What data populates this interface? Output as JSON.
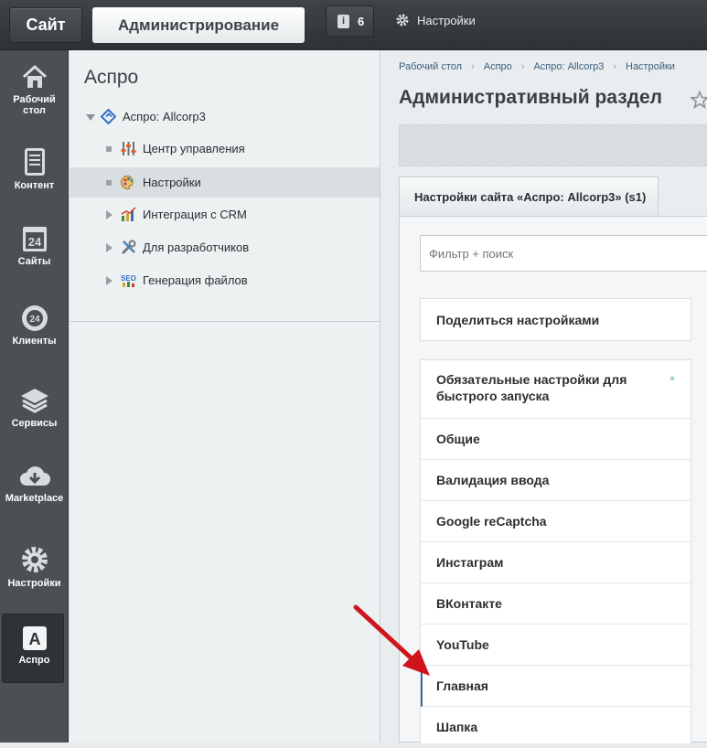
{
  "topbar": {
    "site_label": "Сайт",
    "admin_label": "Администрирование",
    "notifications_count": "6",
    "settings_label": "Настройки"
  },
  "leftmenu": {
    "items": [
      {
        "label": "Рабочий стол",
        "icon": "home-icon"
      },
      {
        "label": "Контент",
        "icon": "document-icon"
      },
      {
        "label": "Сайты",
        "icon": "calendar-24-icon"
      },
      {
        "label": "Клиенты",
        "icon": "clients-24-icon"
      },
      {
        "label": "Сервисы",
        "icon": "layers-icon"
      },
      {
        "label": "Marketplace",
        "icon": "cloud-download-icon"
      },
      {
        "label": "Настройки",
        "icon": "gear-icon"
      },
      {
        "label": "Аспро",
        "icon": "aspro-a-icon"
      }
    ],
    "active": "Аспро"
  },
  "tree": {
    "title": "Аспро",
    "root": "Аспро: Allcorp3",
    "items": [
      {
        "label": "Центр управления",
        "icon": "sliders-icon"
      },
      {
        "label": "Настройки",
        "icon": "palette-icon",
        "selected": true
      },
      {
        "label": "Интеграция с CRM",
        "icon": "chart-icon"
      },
      {
        "label": "Для разработчиков",
        "icon": "tools-icon"
      },
      {
        "label": "Генерация файлов",
        "icon": "seo-icon"
      }
    ]
  },
  "main": {
    "breadcrumbs": [
      "Рабочий стол",
      "Аспро",
      "Аспро: Allcorp3",
      "Настройки"
    ],
    "title": "Административный раздел",
    "tab_label": "Настройки сайта «Аспро: Allcorp3» (s1)",
    "filter_placeholder": "Фильтр + поиск",
    "share_label": "Поделиться настройками",
    "sections": [
      "Обязательные настройки для быстрого запуска",
      "Общие",
      "Валидация ввода",
      "Google reCaptcha",
      "Инстаграм",
      "ВКонтакте",
      "YouTube",
      "Главная",
      "Шапка"
    ],
    "required_marker": "*",
    "active_section": "Главная"
  },
  "colors": {
    "topbar": "#2e3235",
    "leftmenu": "#4a5054",
    "arrow": "#d0141b",
    "link": "#3c5e80"
  }
}
